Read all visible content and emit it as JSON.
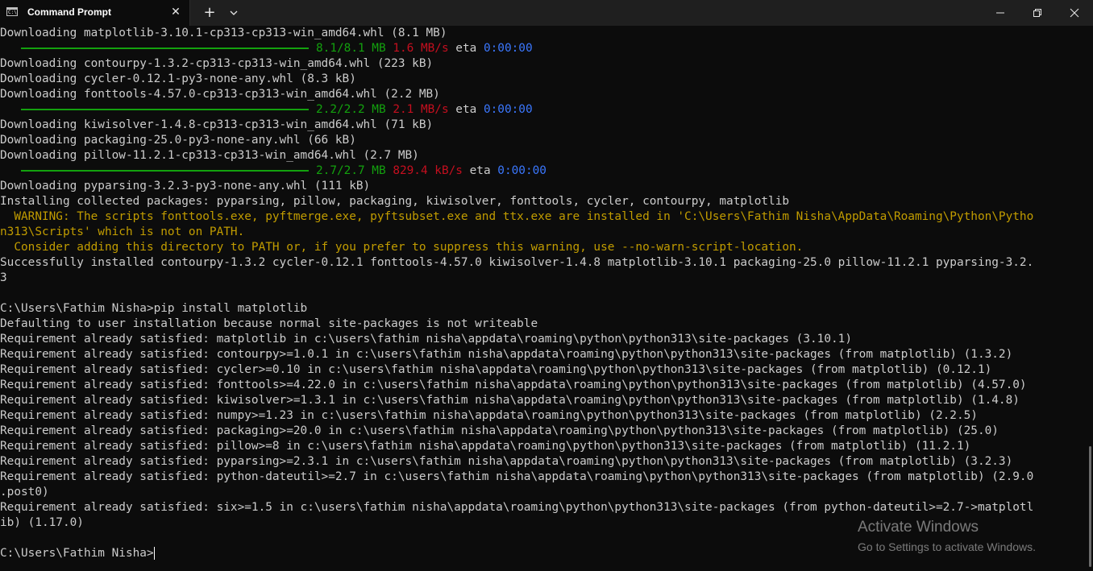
{
  "window": {
    "tab_title": "Command Prompt",
    "tab_icon": "cmd-icon",
    "close_tab_icon": "close-icon",
    "new_tab_icon": "plus-icon",
    "dropdown_icon": "chevron-down-icon",
    "minimize_icon": "minimize-icon",
    "maximize_icon": "maximize-icon",
    "close_window_icon": "close-icon"
  },
  "colors": {
    "background": "#0c0c0c",
    "text": "#cccccc",
    "green": "#13a10e",
    "red": "#c50f1f",
    "blue": "#3b78ff",
    "yellow": "#c19c00"
  },
  "progress": [
    {
      "size": "8.1/8.1 MB",
      "speed": "1.6 MB/s",
      "eta_label": "eta",
      "eta": "0:00:00",
      "fraction": 1.0
    },
    {
      "size": "2.2/2.2 MB",
      "speed": "2.1 MB/s",
      "eta_label": "eta",
      "eta": "0:00:00",
      "fraction": 1.0
    },
    {
      "size": "2.7/2.7 MB",
      "speed": "829.4 kB/s",
      "eta_label": "eta",
      "eta": "0:00:00",
      "fraction": 1.0
    }
  ],
  "lines": [
    "Downloading matplotlib-3.10.1-cp313-cp313-win_amd64.whl (8.1 MB)",
    "Downloading contourpy-1.3.2-cp313-cp313-win_amd64.whl (223 kB)",
    "Downloading cycler-0.12.1-py3-none-any.whl (8.3 kB)",
    "Downloading fonttools-4.57.0-cp313-cp313-win_amd64.whl (2.2 MB)",
    "Downloading kiwisolver-1.4.8-cp313-cp313-win_amd64.whl (71 kB)",
    "Downloading packaging-25.0-py3-none-any.whl (66 kB)",
    "Downloading pillow-11.2.1-cp313-cp313-win_amd64.whl (2.7 MB)",
    "Downloading pyparsing-3.2.3-py3-none-any.whl (111 kB)",
    "Installing collected packages: pyparsing, pillow, packaging, kiwisolver, fonttools, cycler, contourpy, matplotlib",
    "  WARNING: The scripts fonttools.exe, pyftmerge.exe, pyftsubset.exe and ttx.exe are installed in 'C:\\Users\\Fathim Nisha\\AppData\\Roaming\\Python\\Pytho",
    "n313\\Scripts' which is not on PATH.",
    "  Consider adding this directory to PATH or, if you prefer to suppress this warning, use --no-warn-script-location.",
    "Successfully installed contourpy-1.3.2 cycler-0.12.1 fonttools-4.57.0 kiwisolver-1.4.8 matplotlib-3.10.1 packaging-25.0 pillow-11.2.1 pyparsing-3.2.",
    "3",
    "C:\\Users\\Fathim Nisha>pip install matplotlib",
    "Defaulting to user installation because normal site-packages is not writeable",
    "Requirement already satisfied: matplotlib in c:\\users\\fathim nisha\\appdata\\roaming\\python\\python313\\site-packages (3.10.1)",
    "Requirement already satisfied: contourpy>=1.0.1 in c:\\users\\fathim nisha\\appdata\\roaming\\python\\python313\\site-packages (from matplotlib) (1.3.2)",
    "Requirement already satisfied: cycler>=0.10 in c:\\users\\fathim nisha\\appdata\\roaming\\python\\python313\\site-packages (from matplotlib) (0.12.1)",
    "Requirement already satisfied: fonttools>=4.22.0 in c:\\users\\fathim nisha\\appdata\\roaming\\python\\python313\\site-packages (from matplotlib) (4.57.0)",
    "Requirement already satisfied: kiwisolver>=1.3.1 in c:\\users\\fathim nisha\\appdata\\roaming\\python\\python313\\site-packages (from matplotlib) (1.4.8)",
    "Requirement already satisfied: numpy>=1.23 in c:\\users\\fathim nisha\\appdata\\roaming\\python\\python313\\site-packages (from matplotlib) (2.2.5)",
    "Requirement already satisfied: packaging>=20.0 in c:\\users\\fathim nisha\\appdata\\roaming\\python\\python313\\site-packages (from matplotlib) (25.0)",
    "Requirement already satisfied: pillow>=8 in c:\\users\\fathim nisha\\appdata\\roaming\\python\\python313\\site-packages (from matplotlib) (11.2.1)",
    "Requirement already satisfied: pyparsing>=2.3.1 in c:\\users\\fathim nisha\\appdata\\roaming\\python\\python313\\site-packages (from matplotlib) (3.2.3)",
    "Requirement already satisfied: python-dateutil>=2.7 in c:\\users\\fathim nisha\\appdata\\roaming\\python\\python313\\site-packages (from matplotlib) (2.9.0",
    ".post0)",
    "Requirement already satisfied: six>=1.5 in c:\\users\\fathim nisha\\appdata\\roaming\\python\\python313\\site-packages (from python-dateutil>=2.7->matplotl",
    "ib) (1.17.0)",
    "C:\\Users\\Fathim Nisha>"
  ],
  "watermark": {
    "title": "Activate Windows",
    "subtitle": "Go to Settings to activate Windows."
  }
}
